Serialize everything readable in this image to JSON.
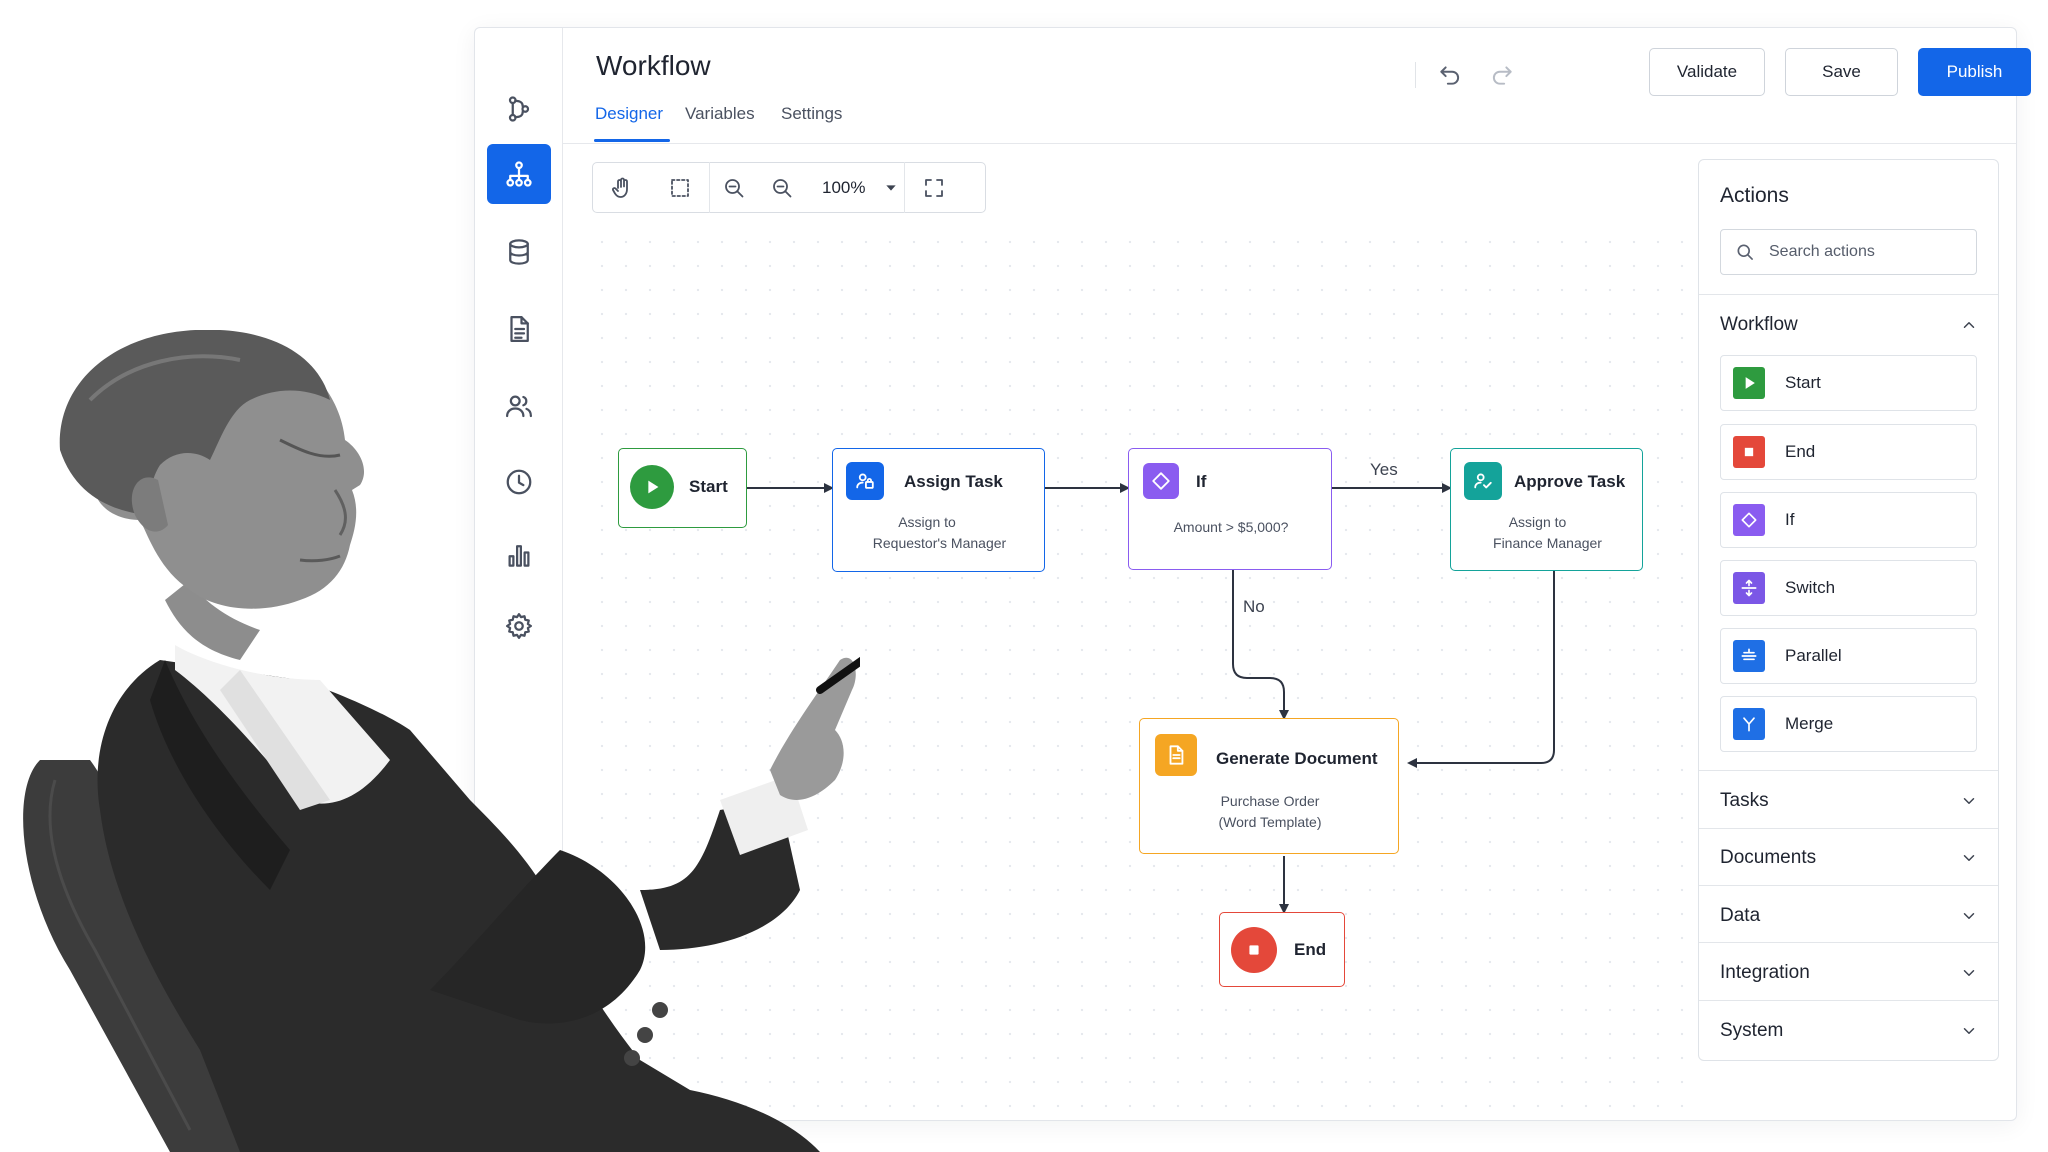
{
  "app": {
    "title": "Workflow",
    "tabs": [
      {
        "label": "Designer",
        "active": true
      },
      {
        "label": "Variables",
        "active": false
      },
      {
        "label": "Settings",
        "active": false
      }
    ],
    "buttons": {
      "validate": "Validate",
      "save": "Save",
      "publish": "Publish"
    },
    "icons": {
      "undo": "undo-icon",
      "redo": "redo-icon",
      "more": "more-vertical-icon"
    }
  },
  "rail": [
    {
      "name": "workflow-tree-icon",
      "active": false
    },
    {
      "name": "hierarchy-icon",
      "active": true
    },
    {
      "name": "database-icon",
      "active": false
    },
    {
      "name": "document-icon",
      "active": false
    },
    {
      "name": "users-icon",
      "active": false
    },
    {
      "name": "clock-icon",
      "active": false
    },
    {
      "name": "bar-chart-icon",
      "active": false
    },
    {
      "name": "gear-icon",
      "active": false
    }
  ],
  "toolbar": {
    "zoom": "100%"
  },
  "nodes": {
    "start": {
      "title": "Start"
    },
    "assign": {
      "title": "Assign Task",
      "sub1": "Assign to",
      "sub2": "Requestor's Manager"
    },
    "if": {
      "title": "If",
      "sub": "Amount > $5,000?"
    },
    "approve": {
      "title": "Approve Task",
      "sub1": "Assign to",
      "sub2": "Finance Manager"
    },
    "generate": {
      "title": "Generate Document",
      "sub1": "Purchase Order",
      "sub2": "(Word Template)"
    },
    "end": {
      "title": "End"
    }
  },
  "edges": {
    "yes": "Yes",
    "no": "No"
  },
  "panel": {
    "title": "Actions",
    "search_placeholder": "Search actions",
    "workflow_section": "Workflow",
    "workflow_items": [
      {
        "label": "Start",
        "color": "#2e9b3f"
      },
      {
        "label": "End",
        "color": "#e4483a"
      },
      {
        "label": "If",
        "color": "#8a5cf0"
      },
      {
        "label": "Switch",
        "color": "#7b57e6"
      },
      {
        "label": "Parallel",
        "color": "#1f6fe5"
      },
      {
        "label": "Merge",
        "color": "#1f6fe5"
      }
    ],
    "sections": [
      "Tasks",
      "Documents",
      "Data",
      "Integration",
      "System"
    ]
  },
  "colors": {
    "accent": "#1366e8",
    "start": "#2e9b3f",
    "assign": "#1366e8",
    "if": "#8a5cf0",
    "approve": "#14a39a",
    "generate": "#f5a623",
    "end": "#e4483a"
  }
}
